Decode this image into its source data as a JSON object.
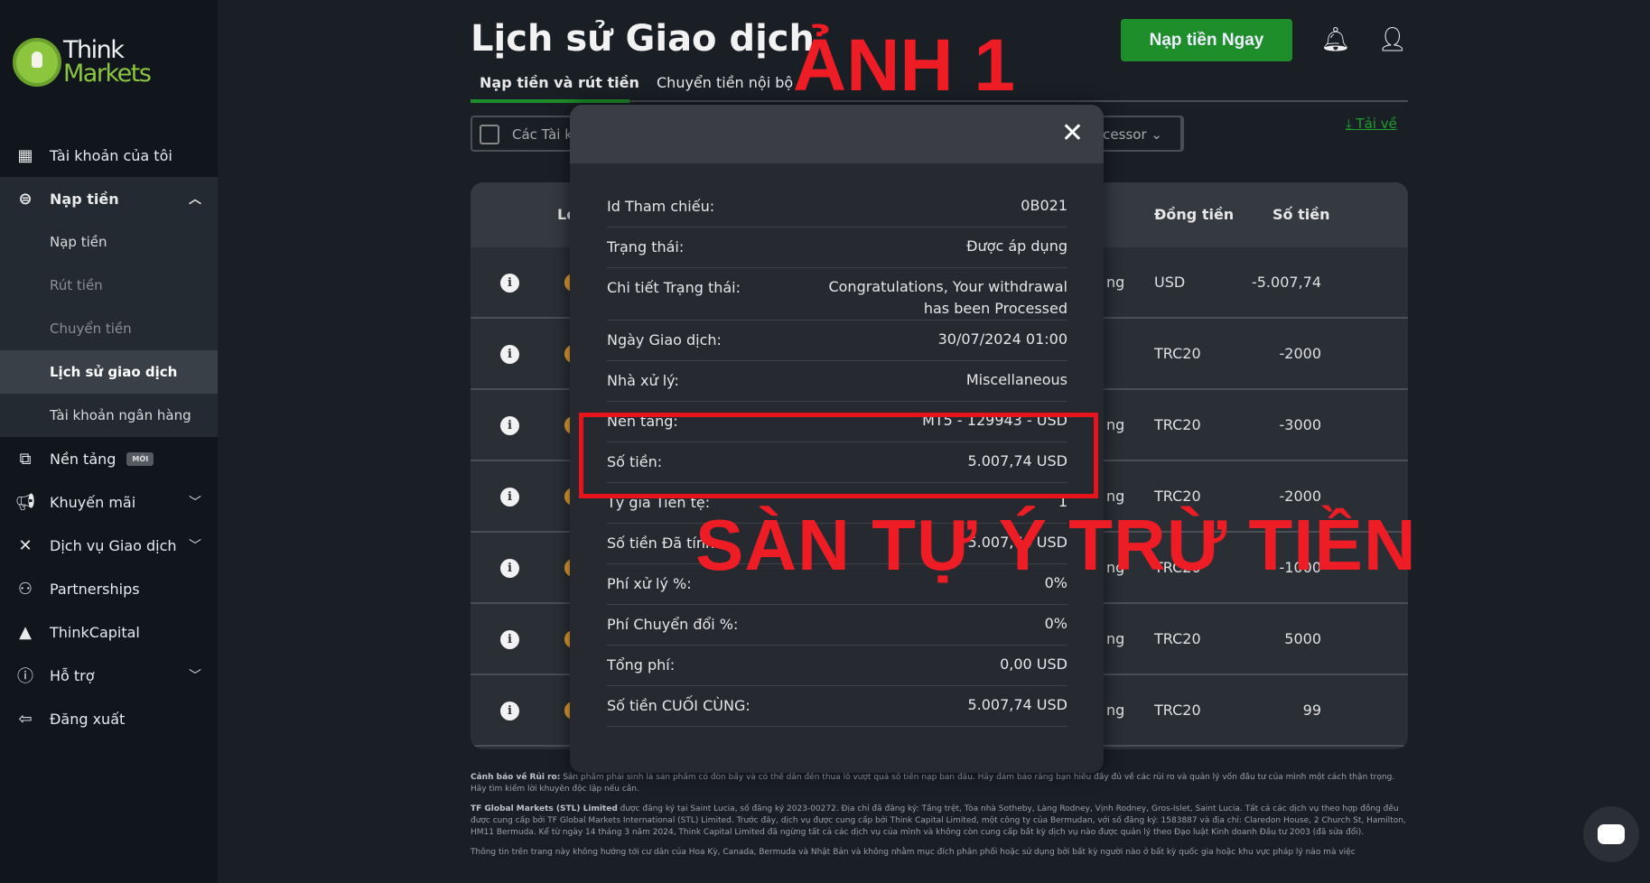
{
  "brand": {
    "logo_line1": "Think",
    "logo_line2": "Markets"
  },
  "sidebar": {
    "items": [
      {
        "label": "Tài khoản của tôi",
        "icon": "dashboard-icon"
      },
      {
        "label": "Nạp tiền",
        "icon": "wallet-icon",
        "expanded": true,
        "children": [
          {
            "label": "Nạp tiền"
          },
          {
            "label": "Rút tiền"
          },
          {
            "label": "Chuyển tiền"
          },
          {
            "label": "Lịch sử giao dịch",
            "active": true
          },
          {
            "label": "Tài khoản ngân hàng"
          }
        ]
      },
      {
        "label": "Nền tảng",
        "icon": "devices-icon",
        "badge": "MỚI"
      },
      {
        "label": "Khuyến mãi",
        "icon": "megaphone-icon"
      },
      {
        "label": "Dịch vụ Giao dịch",
        "icon": "tools-icon"
      },
      {
        "label": "Partnerships",
        "icon": "people-icon"
      },
      {
        "label": "ThinkCapital",
        "icon": "mountain-icon"
      },
      {
        "label": "Hỗ trợ",
        "icon": "info-icon"
      },
      {
        "label": "Đăng xuất",
        "icon": "logout-icon"
      }
    ]
  },
  "header": {
    "title": "Lịch sử Giao dịch",
    "cta": "Nạp tiền Ngay"
  },
  "tabs": [
    "Nạp tiền và rút tiền",
    "Chuyển tiền nội bộ"
  ],
  "filters": {
    "accounts": "Các Tài k",
    "processor": "ocessor",
    "download": "Tải về"
  },
  "table": {
    "headers": {
      "type": "Lo",
      "currency": "Đồng tiền",
      "amount": "Số tiền"
    },
    "rows": [
      {
        "status": "ng",
        "currency": "USD",
        "amount": "-5.007,74"
      },
      {
        "status": "",
        "currency": "TRC20",
        "amount": "-2000"
      },
      {
        "status": "ng",
        "currency": "TRC20",
        "amount": "-3000"
      },
      {
        "status": "ng",
        "currency": "TRC20",
        "amount": "-2000"
      },
      {
        "status": "ng",
        "currency": "TRC20",
        "amount": "-1000"
      },
      {
        "status": "ng",
        "currency": "TRC20",
        "amount": "5000"
      },
      {
        "status": "ng",
        "currency": "TRC20",
        "amount": "99"
      }
    ]
  },
  "modal": {
    "rows": [
      {
        "k": "Id Tham chiếu:",
        "v": "0B021"
      },
      {
        "k": "Trạng thái:",
        "v": "Được áp dụng"
      },
      {
        "k": "Chi tiết Trạng thái:",
        "v": "Congratulations, Your withdrawal has been Processed"
      },
      {
        "k": "Ngày Giao dịch:",
        "v": "30/07/2024 01:00"
      },
      {
        "k": "Nhà xử lý:",
        "v": "Miscellaneous"
      },
      {
        "k": "Nền tảng:",
        "v": "MT5 - 129943 - USD"
      },
      {
        "k": "Số tiền:",
        "v": "5.007,74 USD"
      },
      {
        "k": "Tỷ giá Tiền tệ:",
        "v": "1"
      },
      {
        "k": "Số tiền Đã tính:",
        "v": "5.007,74 USD"
      },
      {
        "k": "Phí xử lý %:",
        "v": "0%"
      },
      {
        "k": "Phí Chuyển đổi %:",
        "v": "0%"
      },
      {
        "k": "Tổng phí:",
        "v": "0,00 USD"
      },
      {
        "k": "Số tiền CUỐI CÙNG:",
        "v": "5.007,74 USD"
      }
    ]
  },
  "annotations": {
    "label1": "ẢNH 1",
    "label2": "SÀN TỰ Ý TRỪ TIỀN",
    "color": "#ee1c24"
  },
  "footer": {
    "p1_bold": "Cảnh báo về Rủi ro:",
    "p1": " Sản phẩm phái sinh là sản phẩm có đòn bẩy và có thể dẫn đến thua lỗ vượt quá số tiền nạp ban đầu. Hãy đảm bảo rằng bạn hiểu đầy đủ về các rủi ro và quản lý vốn đầu tư của mình một cách thận trọng. Hãy tìm kiếm lời khuyên độc lập nếu cần.",
    "p2_bold": "TF Global Markets (STL) Limited",
    "p2": " được đăng ký tại Saint Lucia, số đăng ký 2023-00272. Địa chỉ đã đăng ký: Tầng trệt, Tòa nhà Sotheby, Làng Rodney, Vịnh Rodney, Gros-Islet, Saint Lucia. Tất cả các dịch vụ theo hợp đồng đều được cung cấp bởi TF Global Markets International (STL) Limited. Trước đây, dịch vụ được cung cấp bởi Think Capital Limited, một công ty của Bermudan, với số đăng ký: 1583887 và địa chỉ: Claredon House, 2 Church St, Hamilton, HM11 Bermuda. Kể từ ngày 14 tháng 3 năm 2024, Think Capital Limited đã ngừng tất cả các dịch vụ của mình và không còn cung cấp bất kỳ dịch vụ nào được quản lý theo Đạo luật Kinh doanh Đầu tư 2003 (đã sửa đổi).",
    "p3": "Thông tin trên trang này không hướng tới cư dân của Hoa Kỳ, Canada, Bermuda và Nhật Bản và không nhằm mục đích phân phối hoặc sử dụng bởi bất kỳ người nào ở bất kỳ quốc gia hoặc khu vực pháp lý nào mà việc"
  },
  "colors": {
    "accent": "#1e8e2a",
    "brand": "#8cc63f",
    "sidebar": "#11161d"
  }
}
